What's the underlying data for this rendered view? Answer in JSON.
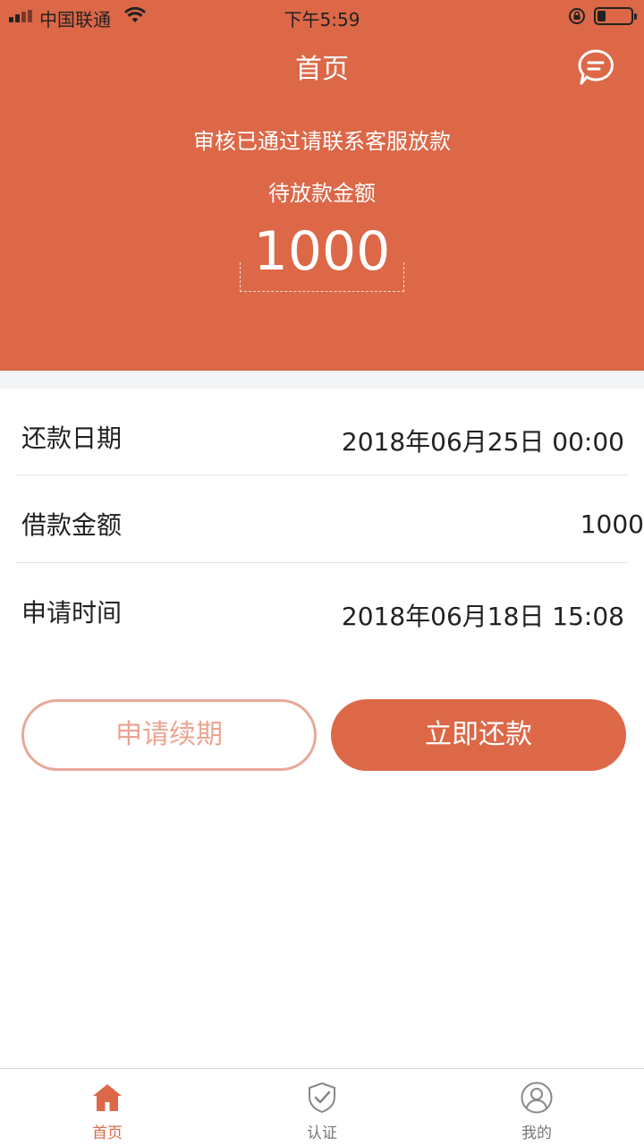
{
  "status_bar": {
    "carrier": "中国联通",
    "time": "下午5:59",
    "battery_level": 0.25
  },
  "header": {
    "title": "首页",
    "status_text": "审核已通过请联系客服放款",
    "amount_label": "待放款金额",
    "amount_value": "1000",
    "message_icon": "chat-bubble-icon"
  },
  "details": [
    {
      "label": "还款日期",
      "value": "2018年06月25日 00:00"
    },
    {
      "label": "借款金额",
      "value": "1000"
    },
    {
      "label": "申请时间",
      "value": "2018年06月18日 15:08"
    }
  ],
  "actions": {
    "renew_label": "申请续期",
    "repay_label": "立即还款"
  },
  "tabbar": {
    "items": [
      {
        "label": "首页",
        "icon": "home-icon",
        "active": true
      },
      {
        "label": "认证",
        "icon": "shield-check-icon",
        "active": false
      },
      {
        "label": "我的",
        "icon": "user-icon",
        "active": false
      }
    ]
  },
  "colors": {
    "brand": "#dc6848",
    "renew_border": "#e8a898",
    "divider": "#e4e4e4"
  }
}
